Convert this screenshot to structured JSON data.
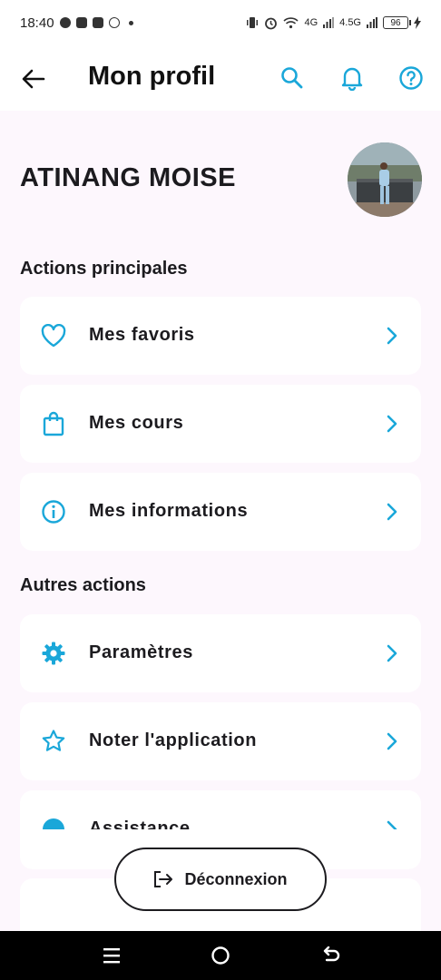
{
  "status_bar": {
    "time": "18:40",
    "network_1": "4G",
    "network_2": "4.5G",
    "battery": "96"
  },
  "app_bar": {
    "title": "Mon profil"
  },
  "profile": {
    "name": "ATINANG MOISE"
  },
  "sections": {
    "main_title": "Actions principales",
    "other_title": "Autres actions"
  },
  "main_actions": [
    {
      "label": "Mes favoris",
      "icon": "heart-icon"
    },
    {
      "label": "Mes cours",
      "icon": "shopping-bag-icon"
    },
    {
      "label": "Mes informations",
      "icon": "info-icon"
    }
  ],
  "other_actions": [
    {
      "label": "Paramètres",
      "icon": "gear-icon"
    },
    {
      "label": "Noter l'application",
      "icon": "star-icon"
    },
    {
      "label": "Assistance",
      "icon": "help-icon"
    }
  ],
  "logout": {
    "label": "Déconnexion"
  },
  "colors": {
    "accent": "#1aa7d9",
    "background": "#fdf7fd",
    "card": "#ffffff",
    "text": "#1c1b1f"
  }
}
